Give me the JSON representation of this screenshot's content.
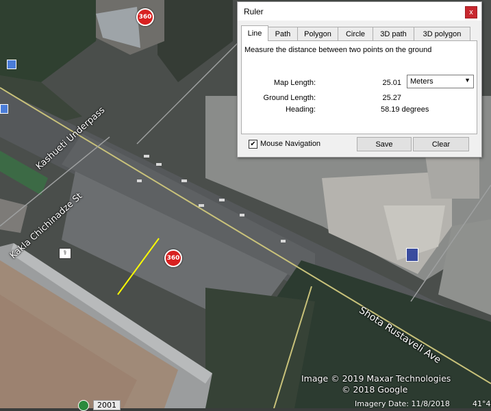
{
  "map": {
    "street_labels": [
      "Kashueti Underpass",
      "Kakla Chichinadze St",
      "Shota Rustaveli Ave"
    ],
    "badge_label": "360",
    "copyright": [
      "Image © 2019 Maxar Technologies",
      "© 2018 Google"
    ],
    "imagery_date": "Imagery Date: 11/8/2018",
    "coord_fragment": "41°4",
    "year_tag": "2001"
  },
  "ruler": {
    "title": "Ruler",
    "close_label": "x",
    "tabs": [
      {
        "label": "Line",
        "active": true
      },
      {
        "label": "Path",
        "active": false
      },
      {
        "label": "Polygon",
        "active": false
      },
      {
        "label": "Circle",
        "active": false
      },
      {
        "label": "3D path",
        "active": false
      },
      {
        "label": "3D polygon",
        "active": false
      }
    ],
    "description": "Measure the distance between two points on the ground",
    "map_length_label": "Map Length:",
    "map_length_value": "25.01",
    "unit_selected": "Meters",
    "ground_length_label": "Ground Length:",
    "ground_length_value": "25.27",
    "heading_label": "Heading:",
    "heading_value": "58.19 degrees",
    "mouse_nav_label": "Mouse Navigation",
    "mouse_nav_checked": "✔",
    "save_label": "Save",
    "clear_label": "Clear"
  }
}
